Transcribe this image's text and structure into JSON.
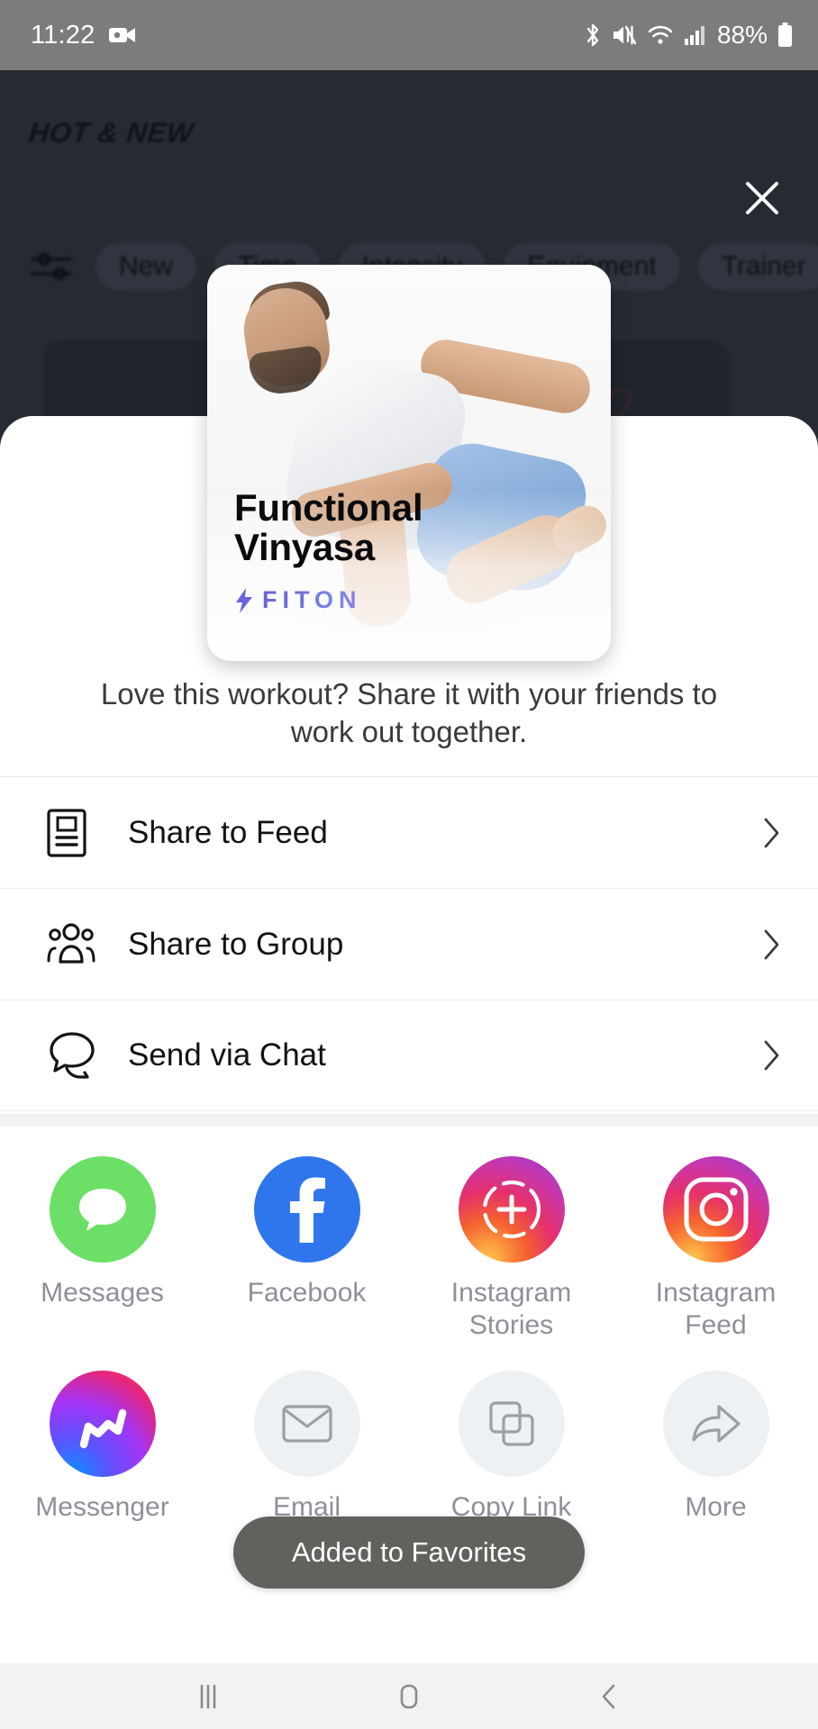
{
  "status_bar": {
    "time": "11:22",
    "battery_percent": "88%",
    "icons": [
      "screen-record-icon",
      "bluetooth-icon",
      "mute-icon",
      "wifi-icon",
      "cellular-signal-icon",
      "battery-icon"
    ]
  },
  "backdrop": {
    "title": "HOT & NEW",
    "close_label": "✕",
    "filter_icon": "filter-sliders-icon",
    "chips": [
      "New",
      "Time",
      "Intensity",
      "Equipment",
      "Trainer"
    ],
    "card_favorite_icon": "heart-outline-icon"
  },
  "workout_card": {
    "title_line1": "Functional",
    "title_line2": "Vinyasa",
    "brand": "FITON",
    "brand_color": "#6b63d8"
  },
  "share_sheet": {
    "prompt": "Love this workout? Share it with your friends to work out together.",
    "rows": [
      {
        "label": "Share to Feed",
        "icon": "feed-icon",
        "chevron": "›"
      },
      {
        "label": "Share to Group",
        "icon": "group-icon",
        "chevron": "›"
      },
      {
        "label": "Send via Chat",
        "icon": "chat-icon",
        "chevron": "›"
      }
    ],
    "apps": [
      {
        "label": "Messages",
        "icon": "messages-icon"
      },
      {
        "label": "Facebook",
        "icon": "facebook-icon"
      },
      {
        "label": "Instagram Stories",
        "icon": "instagram-stories-icon"
      },
      {
        "label": "Instagram Feed",
        "icon": "instagram-feed-icon"
      },
      {
        "label": "Messenger",
        "icon": "messenger-icon"
      },
      {
        "label": "Email",
        "icon": "email-icon"
      },
      {
        "label": "Copy Link",
        "icon": "copy-link-icon"
      },
      {
        "label": "More",
        "icon": "share-more-icon"
      }
    ]
  },
  "toast": {
    "message": "Added to Favorites"
  },
  "nav_bar": {
    "recents_label": "recents-icon",
    "home_label": "home-icon",
    "back_label": "back-icon"
  }
}
